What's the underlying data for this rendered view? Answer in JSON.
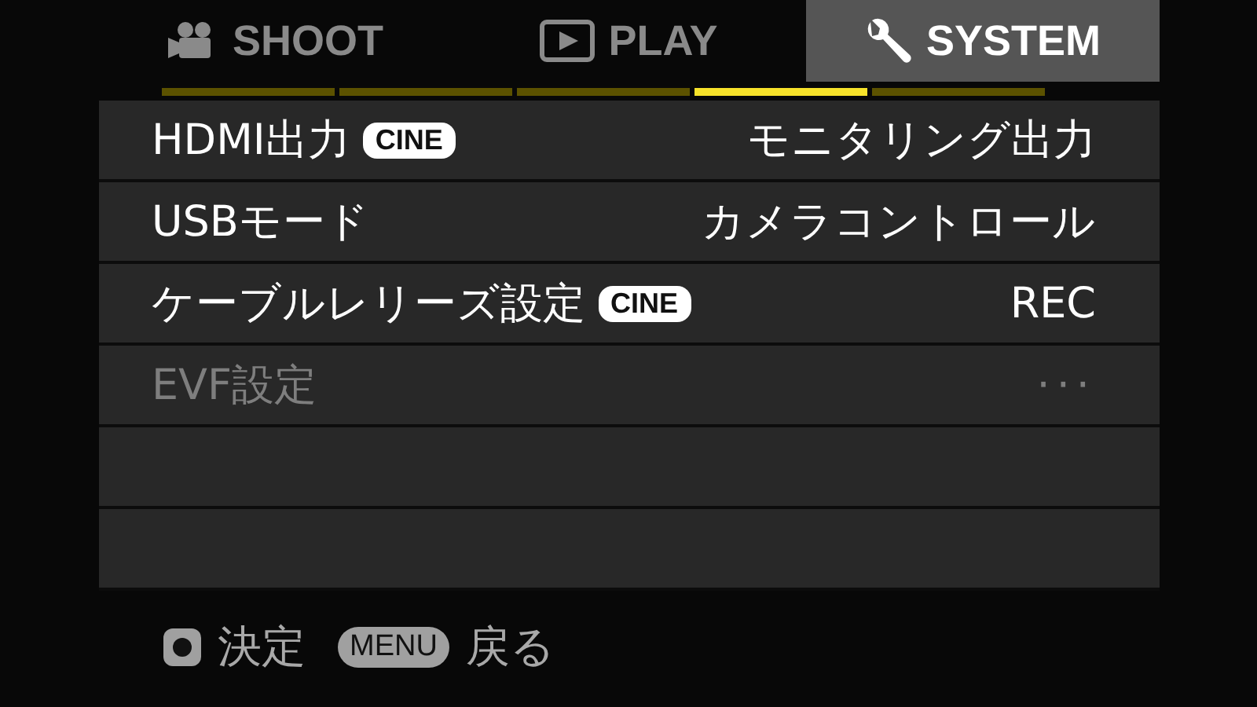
{
  "tabs": [
    {
      "label": "SHOOT",
      "kind": "camera",
      "selected": false
    },
    {
      "label": "PLAY",
      "kind": "play",
      "selected": false
    },
    {
      "label": "SYSTEM",
      "kind": "wrench",
      "selected": true
    }
  ],
  "pages": [
    {
      "selected": false
    },
    {
      "selected": false
    },
    {
      "selected": false
    },
    {
      "selected": true
    },
    {
      "selected": false
    }
  ],
  "menu_items": [
    {
      "label": "HDMI出力",
      "badge": "CINE",
      "value": "モニタリング出力",
      "disabled": false
    },
    {
      "label": "USBモード",
      "value": "カメラコントロール",
      "disabled": false
    },
    {
      "label": "ケーブルレリーズ設定",
      "badge": "CINE",
      "value": "REC",
      "disabled": false
    },
    {
      "label": "EVF設定",
      "value": "···",
      "disabled": true
    }
  ],
  "footer": [
    {
      "kind": "button",
      "text": "決定"
    },
    {
      "kind": "key",
      "key": "MENU",
      "text": "戻る"
    }
  ]
}
